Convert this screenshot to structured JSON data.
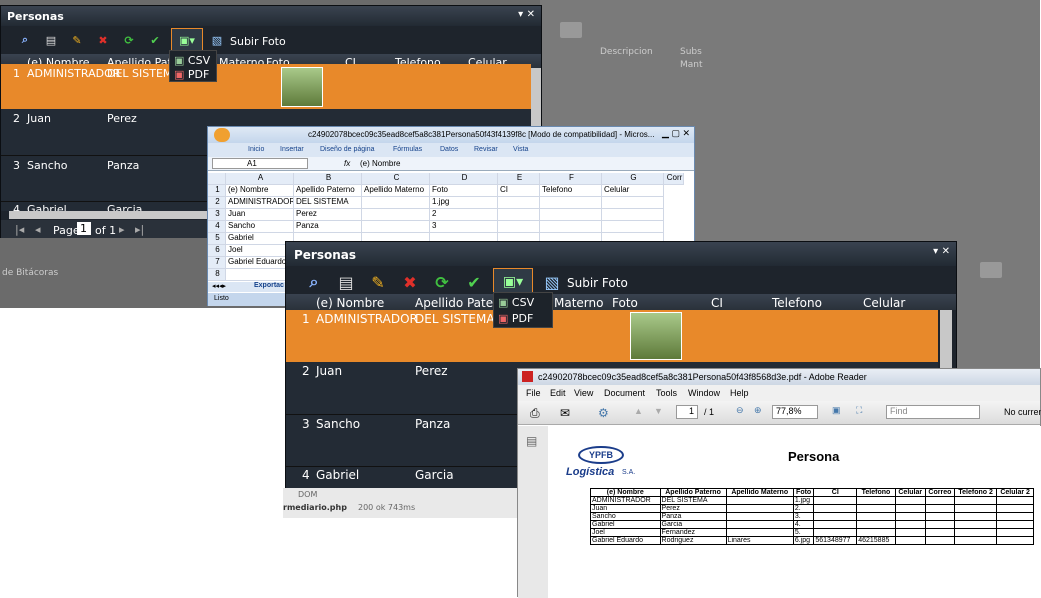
{
  "bg": {
    "descripcion": "Descripcion",
    "subs": "Subs",
    "mant": "Mant",
    "bitacoras": "de Bitácoras",
    "php": "rmediario.php",
    "status": "200 ok 743ms",
    "dom": "DOM"
  },
  "panel1": {
    "title": "Personas",
    "upload": "Subir Foto",
    "cols": [
      "(e) Nombre",
      "Apellido Paterno",
      "Materno",
      "Foto",
      "CI",
      "Telefono",
      "Celular"
    ],
    "rows": [
      {
        "n": "1",
        "nombre": "ADMINISTRADOR",
        "ap": "DEL SISTEMA"
      },
      {
        "n": "2",
        "nombre": "Juan",
        "ap": "Perez"
      },
      {
        "n": "3",
        "nombre": "Sancho",
        "ap": "Panza"
      },
      {
        "n": "4",
        "nombre": "Gabriel",
        "ap": "Garcia"
      }
    ],
    "menu": [
      "CSV",
      "PDF"
    ],
    "page_label": "Page",
    "page_value": "1",
    "of": "of 1"
  },
  "excel": {
    "title": "c24902078bcec09c35ead8cef5a8c381Persona50f43f4139f8c [Modo de compatibilidad] - Micros...",
    "tabs": [
      "Inicio",
      "Insertar",
      "Diseño de página",
      "Fórmulas",
      "Datos",
      "Revisar",
      "Vista"
    ],
    "namebox": "A1",
    "fx": "fx",
    "formula": "(e) Nombre",
    "colhdr": [
      "A",
      "B",
      "C",
      "D",
      "E",
      "F",
      "G",
      "Corr"
    ],
    "rows": [
      [
        "1",
        "(e) Nombre",
        "Apellido Paterno",
        "Apellido Materno",
        "Foto",
        "CI",
        "Telefono",
        "Celular"
      ],
      [
        "2",
        "ADMINISTRADOR",
        "DEL SISTEMA",
        "",
        "1.jpg",
        "",
        "",
        ""
      ],
      [
        "3",
        "Juan",
        "Perez",
        "",
        "2",
        "",
        "",
        ""
      ],
      [
        "4",
        "Sancho",
        "Panza",
        "",
        "3",
        "",
        "",
        ""
      ],
      [
        "5",
        "Gabriel",
        "",
        "",
        "",
        "",
        "",
        ""
      ],
      [
        "6",
        "Joel",
        "",
        "",
        "",
        "",
        "",
        ""
      ],
      [
        "7",
        "Gabriel Eduardo",
        "",
        "",
        "",
        "",
        "",
        ""
      ],
      [
        "8",
        "",
        "",
        "",
        "",
        "",
        "",
        ""
      ]
    ],
    "sheet": "Exportac",
    "status": "Listo"
  },
  "panel2": {
    "title": "Personas",
    "upload": "Subir Foto",
    "cols": [
      "(e) Nombre",
      "Apellido Paterno",
      "Materno",
      "Foto",
      "CI",
      "Telefono",
      "Celular"
    ],
    "rows": [
      {
        "n": "1",
        "nombre": "ADMINISTRADOR",
        "ap": "DEL SISTEMA"
      },
      {
        "n": "2",
        "nombre": "Juan",
        "ap": "Perez"
      },
      {
        "n": "3",
        "nombre": "Sancho",
        "ap": "Panza"
      },
      {
        "n": "4",
        "nombre": "Gabriel",
        "ap": "Garcia"
      }
    ],
    "menu": [
      "CSV",
      "PDF"
    ]
  },
  "pdf": {
    "title": "c24902078bcec09c35ead8cef5a8c381Persona50f43f8568d3e.pdf - Adobe Reader",
    "menu": [
      "File",
      "Edit",
      "View",
      "Document",
      "Tools",
      "Window",
      "Help"
    ],
    "page": "1",
    "pages": "/ 1",
    "zoom": "77,8%",
    "find": "Find",
    "nocur": "No curren",
    "logo": "YPFB",
    "logo2": "Logística",
    "logo3": "S.A.",
    "heading": "Persona",
    "cols": [
      "(e) Nombre",
      "Apellido Paterno",
      "Apellido Materno",
      "Foto",
      "CI",
      "Telefono",
      "Celular",
      "Correo",
      "Telefono 2",
      "Celular 2"
    ],
    "rows": [
      [
        "ADMINISTRADOR",
        "DEL SISTEMA",
        "",
        "1.jpg",
        "",
        "",
        "",
        "",
        "",
        ""
      ],
      [
        "Juan",
        "Perez",
        "",
        "2.",
        "",
        "",
        "",
        "",
        "",
        ""
      ],
      [
        "Sancho",
        "Panza",
        "",
        "3.",
        "",
        "",
        "",
        "",
        "",
        ""
      ],
      [
        "Gabriel",
        "Garcia",
        "",
        "4.",
        "",
        "",
        "",
        "",
        "",
        ""
      ],
      [
        "Joel",
        "Fernandez",
        "",
        "5.",
        "",
        "",
        "",
        "",
        "",
        ""
      ],
      [
        "Gabriel Eduardo",
        "Rodriguez",
        "Linares",
        "6.jpg",
        "561348977",
        "46215885",
        "",
        "",
        "",
        ""
      ]
    ]
  },
  "colors": {
    "selected": "#e8892a",
    "panel": "#1e242c"
  }
}
